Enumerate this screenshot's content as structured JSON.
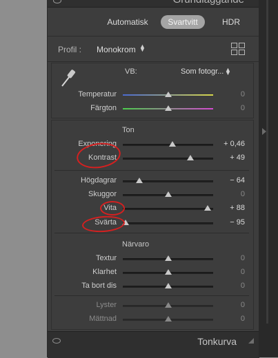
{
  "header": {
    "title": "Grundläggande"
  },
  "treatment": {
    "tabs": [
      "Automatisk",
      "Svartvitt",
      "HDR"
    ],
    "active": "Svartvitt"
  },
  "profile": {
    "label": "Profil :",
    "value": "Monokrom"
  },
  "white_balance": {
    "label": "VB:",
    "value": "Som fotogr..."
  },
  "color_sliders": [
    {
      "label": "Temperatur",
      "value": "0",
      "level": 0.5
    },
    {
      "label": "Färgton",
      "value": "0",
      "level": 0.5
    }
  ],
  "tone": {
    "title": "Ton",
    "sliders": [
      {
        "label": "Exponering",
        "value": "+ 0,46",
        "level": 0.55
      },
      {
        "label": "Kontrast",
        "value": "+ 49",
        "level": 0.75
      },
      {
        "label": "Högdagrar",
        "value": "− 64",
        "level": 0.18
      },
      {
        "label": "Skuggor",
        "value": "0",
        "level": 0.5
      },
      {
        "label": "Vita",
        "value": "+ 88",
        "level": 0.94
      },
      {
        "label": "Svärta",
        "value": "− 95",
        "level": 0.03
      }
    ]
  },
  "presence": {
    "title": "Närvaro",
    "sliders": [
      {
        "label": "Textur",
        "value": "0",
        "level": 0.5
      },
      {
        "label": "Klarhet",
        "value": "0",
        "level": 0.5
      },
      {
        "label": "Ta bort dis",
        "value": "0",
        "level": 0.5
      },
      {
        "label": "Lyster",
        "value": "0",
        "level": 0.5,
        "disabled": true
      },
      {
        "label": "Mättnad",
        "value": "0",
        "level": 0.5,
        "disabled": true
      }
    ]
  },
  "footer": {
    "title": "Tonkurva"
  },
  "colors": {
    "panel": "#3d3d3d",
    "annotation": "#d52020"
  }
}
